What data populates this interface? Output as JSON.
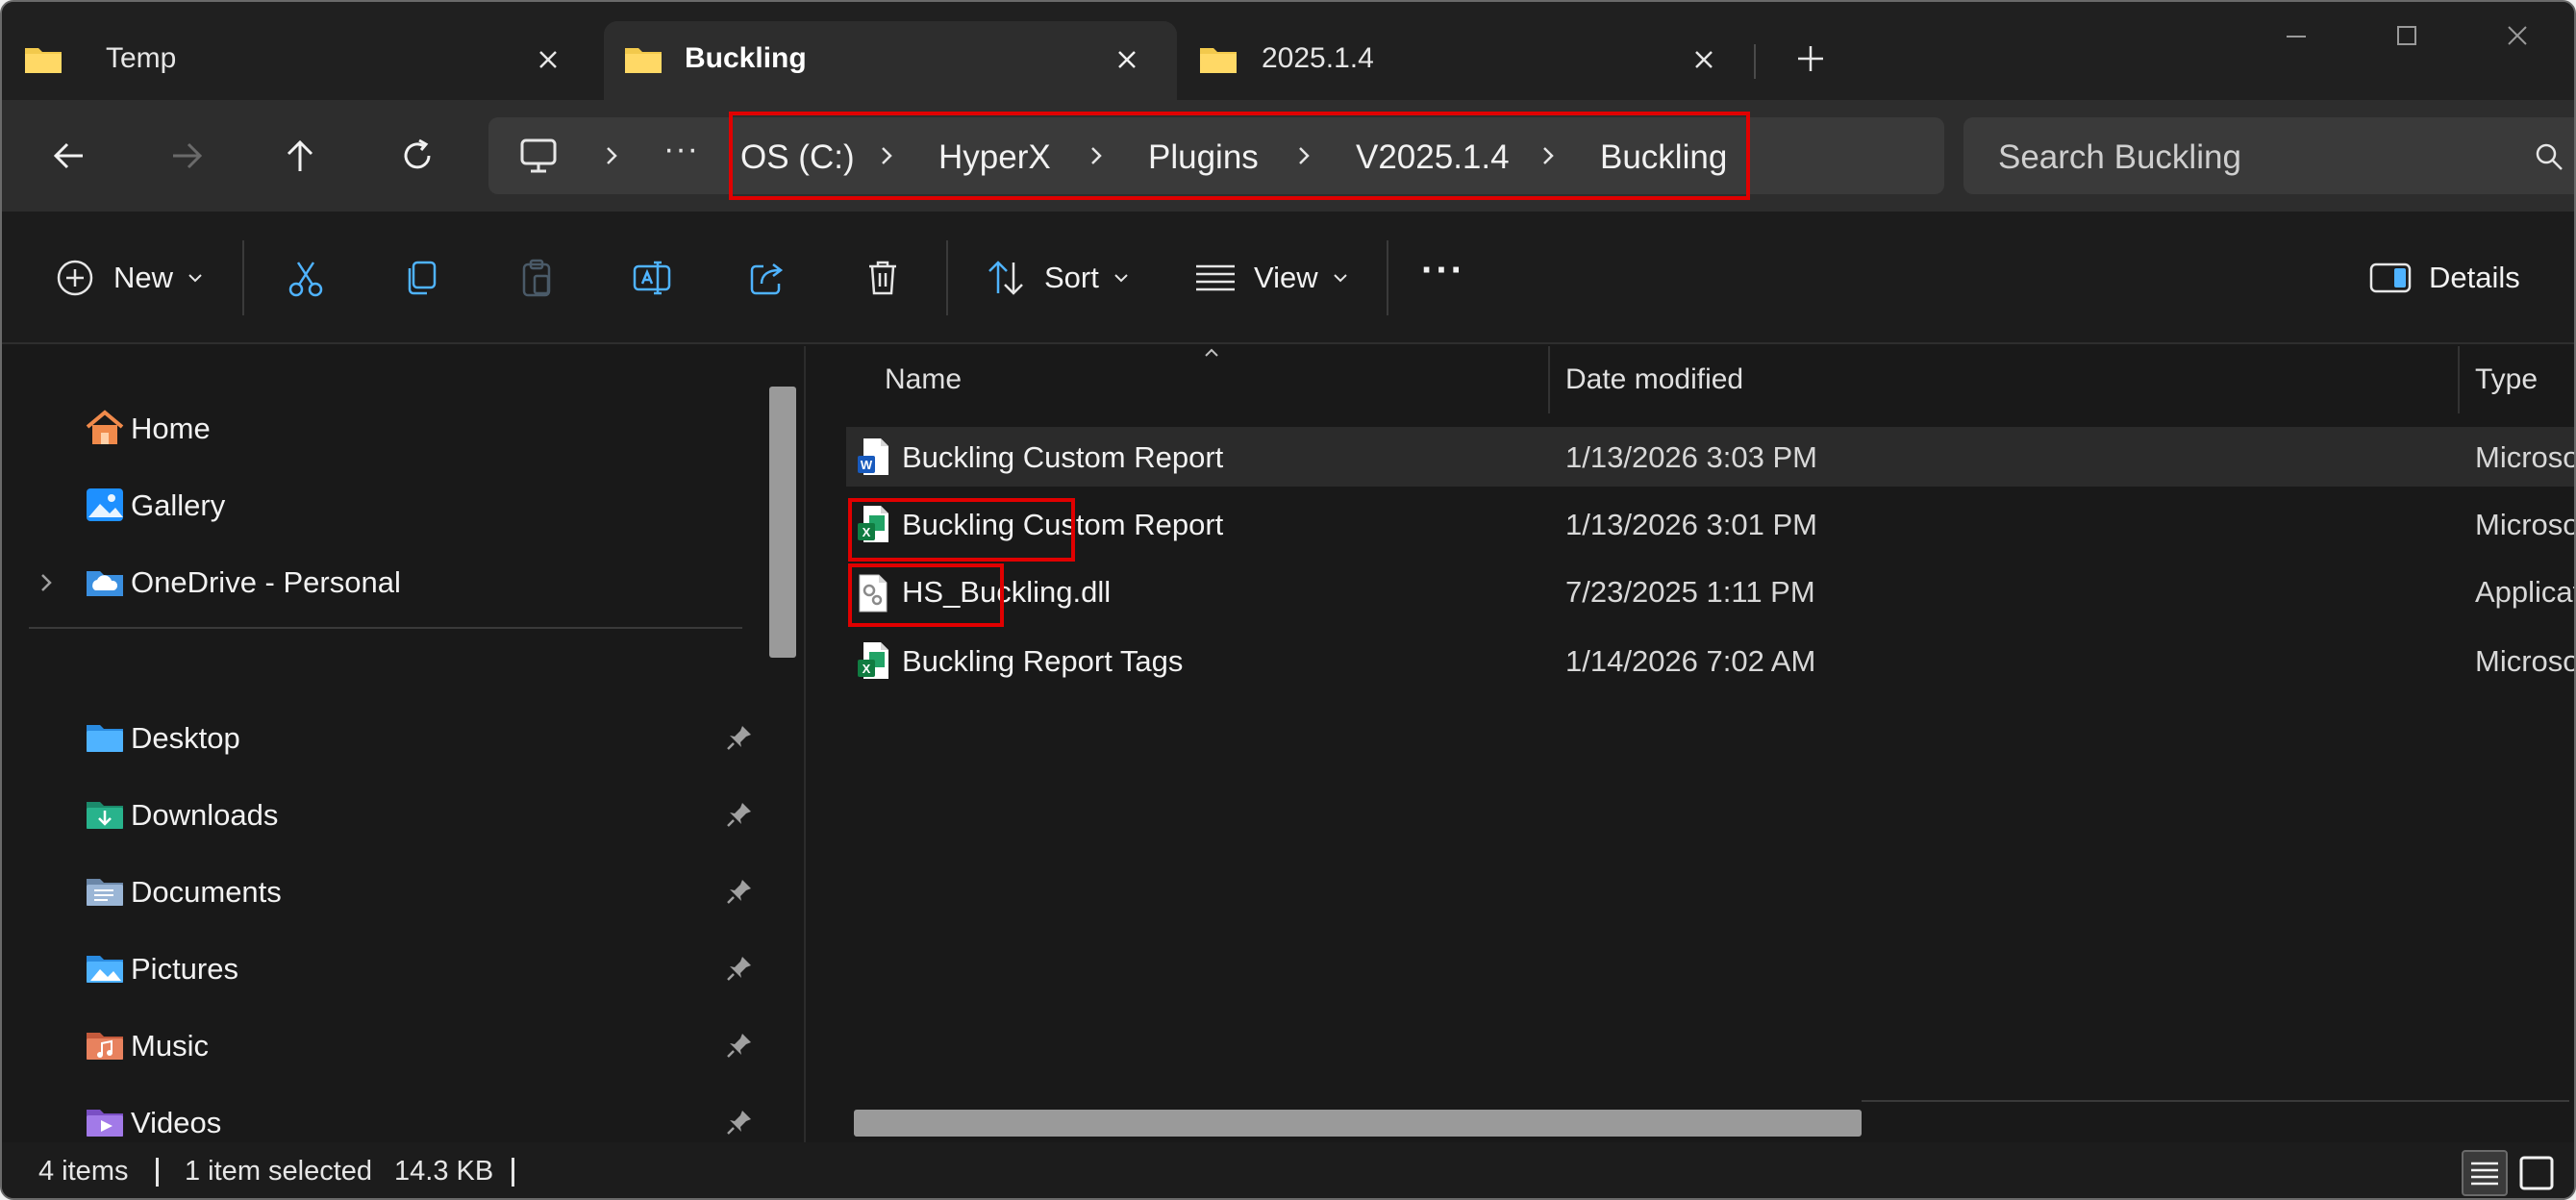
{
  "tabs": [
    {
      "label": "Temp"
    },
    {
      "label": "Buckling"
    },
    {
      "label": "2025.1.4"
    }
  ],
  "address": {
    "overflow": "···",
    "crumbs": [
      "OS (C:)",
      "HyperX",
      "Plugins",
      "V2025.1.4",
      "Buckling"
    ]
  },
  "search": {
    "placeholder": "Search Buckling"
  },
  "toolbar": {
    "new_label": "New",
    "sort_label": "Sort",
    "view_label": "View",
    "more_label": "···",
    "details_label": "Details"
  },
  "sidebar": {
    "items": [
      {
        "label": "Home",
        "icon": "home-icon"
      },
      {
        "label": "Gallery",
        "icon": "gallery-icon"
      },
      {
        "label": "OneDrive - Personal",
        "icon": "onedrive-icon"
      },
      {
        "label": "Desktop",
        "icon": "desktop-folder-icon"
      },
      {
        "label": "Downloads",
        "icon": "downloads-folder-icon"
      },
      {
        "label": "Documents",
        "icon": "documents-folder-icon"
      },
      {
        "label": "Pictures",
        "icon": "pictures-folder-icon"
      },
      {
        "label": "Music",
        "icon": "music-folder-icon"
      },
      {
        "label": "Videos",
        "icon": "videos-folder-icon"
      }
    ]
  },
  "columns": {
    "name": "Name",
    "date": "Date modified",
    "type": "Type"
  },
  "files": [
    {
      "name": "Buckling Custom Report",
      "date": "1/13/2026 3:03 PM",
      "type": "Microsoft Word Document",
      "icon": "word-file-icon"
    },
    {
      "name": "Buckling Custom Report",
      "date": "1/13/2026 3:01 PM",
      "type": "Microsoft Excel Worksheet",
      "icon": "excel-file-icon"
    },
    {
      "name": "HS_Buckling.dll",
      "date": "7/23/2025 1:11 PM",
      "type": "Application extension",
      "icon": "dll-file-icon"
    },
    {
      "name": "Buckling Report Tags",
      "date": "1/14/2026 7:02 AM",
      "type": "Microsoft Excel Worksheet",
      "icon": "excel-file-icon"
    }
  ],
  "status": {
    "count": "4 items",
    "selected": "1 item selected",
    "size": "14.3 KB"
  },
  "colors": {
    "highlight_box": "#e00000",
    "folder": "#f2c94c",
    "word": "#185abd",
    "excel": "#107c41"
  }
}
